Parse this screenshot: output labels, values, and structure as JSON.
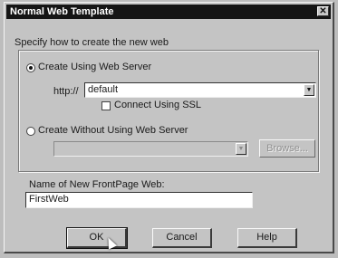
{
  "window": {
    "title": "Normal Web Template",
    "close_glyph": "✕"
  },
  "instruction": "Specify how to create the new web",
  "options": {
    "with_server": {
      "label": "Create Using Web Server",
      "selected": true
    },
    "url_prefix": "http://",
    "server_value": "default",
    "ssl_label": "Connect Using SSL",
    "ssl_checked": false,
    "without_server": {
      "label": "Create Without Using Web Server",
      "selected": false
    },
    "browse_label": "Browse..."
  },
  "name_field": {
    "label": "Name of New FrontPage Web:",
    "value": "FirstWeb"
  },
  "buttons": {
    "ok": "OK",
    "cancel": "Cancel",
    "help": "Help"
  },
  "icons": {
    "dropdown": "chevron-down-icon",
    "cursor": "mouse-pointer-icon"
  }
}
